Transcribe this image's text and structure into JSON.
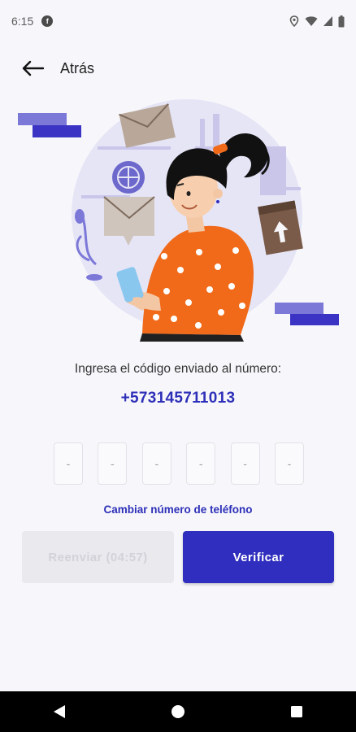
{
  "status_bar": {
    "time": "6:15",
    "app_icon_letter": "f",
    "icons": [
      "location-icon",
      "wifi-icon",
      "signal-icon",
      "battery-icon"
    ]
  },
  "header": {
    "back_label": "Atrás"
  },
  "verification": {
    "prompt": "Ingresa el código enviado al número:",
    "phone_number": "+573145711013",
    "code_placeholders": [
      "-",
      "-",
      "-",
      "-",
      "-",
      "-"
    ],
    "change_phone_link": "Cambiar número de teléfono"
  },
  "buttons": {
    "resend_label": "Reenviar (04:57)",
    "verify_label": "Verificar"
  },
  "colors": {
    "accent": "#2f2ebe",
    "background": "#f7f7fb",
    "shirt": "#f06a1a",
    "illustration_purple": "#7c78d8"
  },
  "nav_bar": {
    "items": [
      "back-triangle-icon",
      "home-circle-icon",
      "recents-square-icon"
    ]
  }
}
